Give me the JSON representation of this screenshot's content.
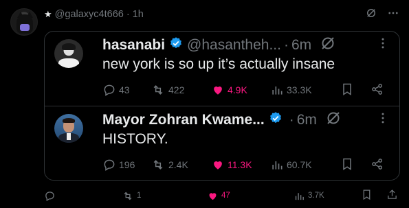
{
  "outer_post": {
    "handle": "@galaxyc4t666",
    "separator": "·",
    "time": "1h",
    "icons": [
      "star-icon",
      "grok-icon",
      "more-icon"
    ]
  },
  "quotes": [
    {
      "name": "hasanabi",
      "handle": "@hasantheh...",
      "separator": "·",
      "time": "6m",
      "text": "new york is so up it’s actually insane",
      "replies": "43",
      "reposts": "422",
      "likes": "4.9K",
      "views": "33.3K"
    },
    {
      "name": "Mayor Zohran Kwame...",
      "handle": "",
      "separator": "·",
      "time": "6m",
      "text": "HISTORY.",
      "replies": "196",
      "reposts": "2.4K",
      "likes": "11.3K",
      "views": "60.7K"
    }
  ],
  "bottom_actions": {
    "replies": "",
    "reposts": "1",
    "likes": "47",
    "views": "3.7K"
  },
  "colors": {
    "background": "#000000",
    "text": "#e7e9ea",
    "muted": "#71767b",
    "like": "#f91880",
    "verified": "#1d9bf0",
    "border": "#2f3336"
  }
}
